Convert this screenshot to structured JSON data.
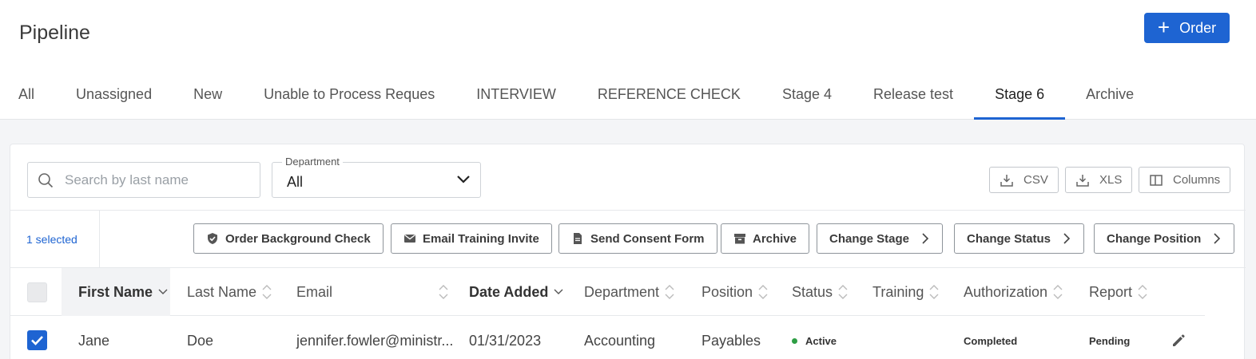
{
  "header": {
    "title": "Pipeline",
    "order_button_label": "Order"
  },
  "tabs": [
    {
      "label": "All"
    },
    {
      "label": "Unassigned"
    },
    {
      "label": "New"
    },
    {
      "label": "Unable to Process Reques"
    },
    {
      "label": "INTERVIEW"
    },
    {
      "label": "REFERENCE CHECK"
    },
    {
      "label": "Stage 4"
    },
    {
      "label": "Release test"
    },
    {
      "label": "Stage 6",
      "active": true
    },
    {
      "label": "Archive"
    }
  ],
  "filters": {
    "search_placeholder": "Search by last name",
    "search_value": "",
    "department_label": "Department",
    "department_value": "All"
  },
  "export": {
    "csv_label": "CSV",
    "xls_label": "XLS",
    "columns_label": "Columns"
  },
  "selection": {
    "count_text": "1 selected"
  },
  "actions": {
    "order_bg_check": "Order Background Check",
    "email_training": "Email Training Invite",
    "send_consent": "Send Consent Form",
    "archive": "Archive",
    "change_stage": "Change Stage",
    "change_status": "Change Status",
    "change_position": "Change Position"
  },
  "table": {
    "columns": [
      "First Name",
      "Last Name",
      "Email",
      "Date Added",
      "Department",
      "Position",
      "Status",
      "Training",
      "Authorization",
      "Report"
    ],
    "rows": [
      {
        "checked": true,
        "first_name": "Jane",
        "last_name": "Doe",
        "email": "jennifer.fowler@ministr...",
        "date_added": "01/31/2023",
        "department": "Accounting",
        "position": "Payables",
        "status": "Active",
        "training": "",
        "authorization": "Completed",
        "report": "Pending"
      }
    ]
  },
  "colors": {
    "accent": "#1e64d2",
    "status_active": "#2e9e44"
  }
}
